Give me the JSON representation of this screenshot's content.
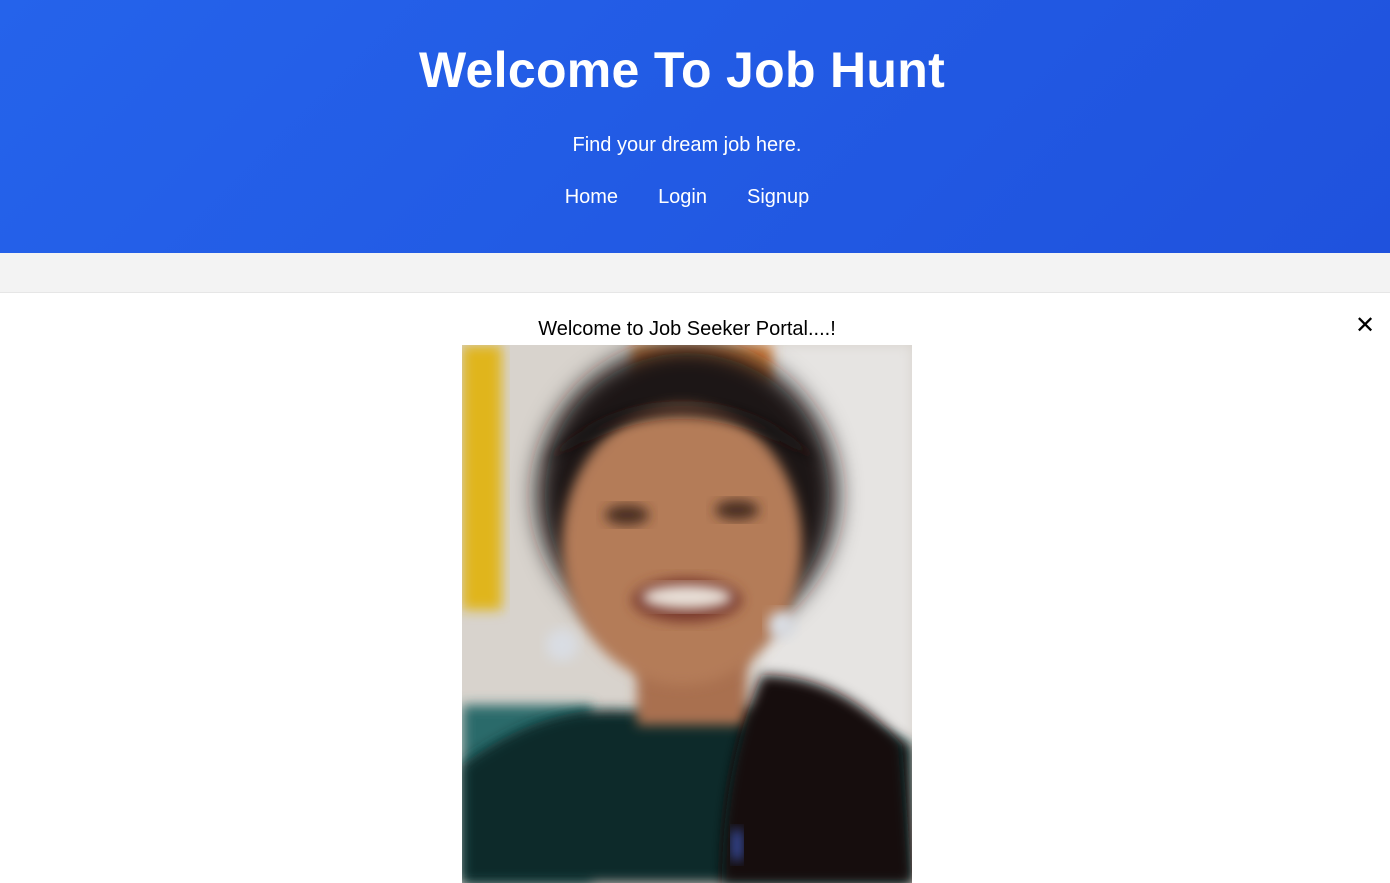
{
  "header": {
    "title": "Welcome To Job Hunt",
    "tagline": "Find your dream job here.",
    "nav": [
      "Home",
      "Login",
      "Signup"
    ]
  },
  "modal": {
    "message": "Welcome to Job Seeker Portal....!",
    "close_icon": "close-icon"
  },
  "colors": {
    "header_bg": "#2563eb",
    "band_bg": "#f3f3f3"
  }
}
